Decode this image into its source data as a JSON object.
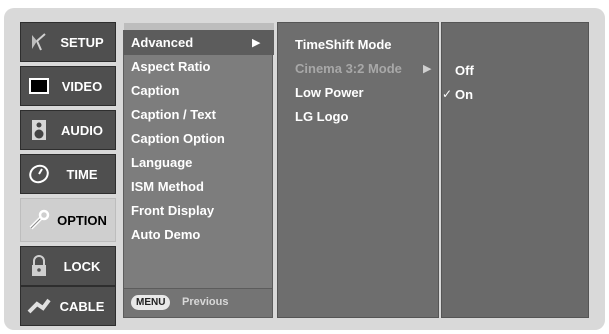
{
  "sidebar": {
    "items": [
      {
        "label": "SETUP",
        "icon": "satellite-dish-icon"
      },
      {
        "label": "VIDEO",
        "icon": "tv-screen-icon"
      },
      {
        "label": "AUDIO",
        "icon": "speaker-icon"
      },
      {
        "label": "TIME",
        "icon": "clock-icon"
      },
      {
        "label": "OPTION",
        "icon": "wrench-icon"
      },
      {
        "label": "LOCK",
        "icon": "padlock-icon"
      },
      {
        "label": "CABLE",
        "icon": "cable-connector-icon"
      }
    ],
    "active": "OPTION"
  },
  "submenu": {
    "items": [
      "Advanced",
      "Aspect Ratio",
      "Caption",
      "Caption / Text",
      "Caption Option",
      "Language",
      "ISM Method",
      "Front Display",
      "Auto Demo"
    ],
    "selected": "Advanced",
    "footer": {
      "menu_button": "MENU",
      "previous_label": "Previous"
    }
  },
  "advanced_menu": {
    "items": [
      "TimeShift Mode",
      "Cinema 3:2 Mode",
      "Low Power",
      "LG Logo"
    ],
    "selected": "Cinema 3:2 Mode"
  },
  "cinema_options": {
    "items": [
      "Off",
      "On"
    ],
    "checked": "On",
    "check_mark": "✓"
  },
  "arrow_glyph": "▶"
}
